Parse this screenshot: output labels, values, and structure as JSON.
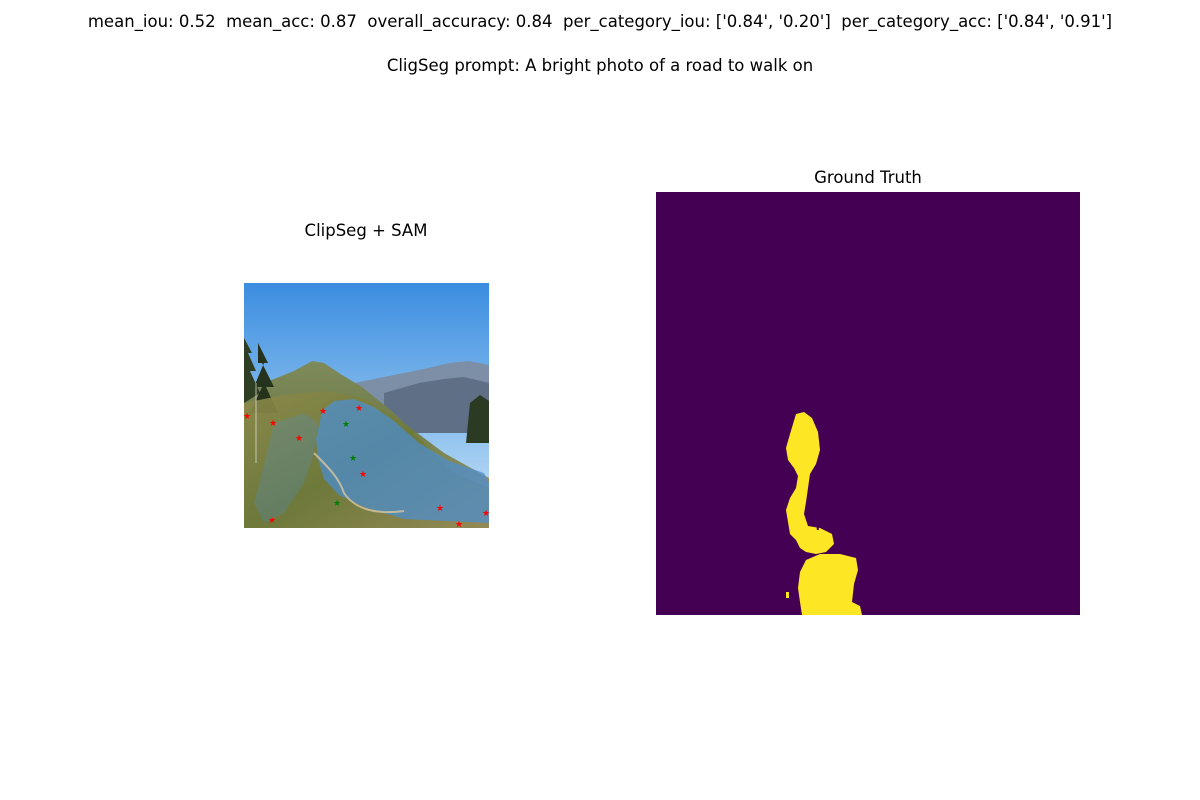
{
  "header": {
    "metrics": "mean_iou: 0.52  mean_acc: 0.87  overall_accuracy: 0.84  per_category_iou: ['0.84', '0.20']  per_category_acc: ['0.84', '0.91']",
    "prompt": "CligSeg prompt: A bright photo of a road to walk on"
  },
  "panels": {
    "left": {
      "title": "ClipSeg + SAM"
    },
    "right": {
      "title": "Ground Truth"
    }
  },
  "colors": {
    "mask_background": "#440154",
    "mask_foreground": "#fde725",
    "positive_point": "#008000",
    "negative_point": "#ff0000",
    "segmentation_overlay": "#4a8fd6"
  },
  "icons": {
    "positive_point": "green-star-icon",
    "negative_point": "red-star-icon"
  }
}
